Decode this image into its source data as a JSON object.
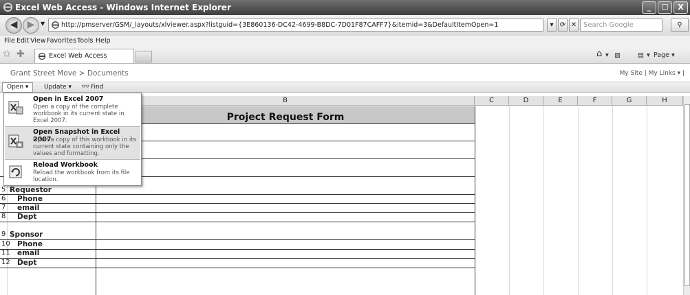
{
  "window": {
    "title": "Excel Web Access - Windows Internet Explorer",
    "controls": {
      "minimize": "_",
      "maximize": "☐",
      "close": "X"
    }
  },
  "browser": {
    "address": "http://pmserver/GSM/_layouts/xlviewer.aspx?listguid={3E860136-DC42-4699-B8DC-7D01F87CAFF7}&itemid=3&DefaultItemOpen=1",
    "search_placeholder": "Search Google",
    "menu": [
      "File",
      "Edit",
      "View",
      "Favorites",
      "Tools",
      "Help"
    ],
    "tab_title": "Excel Web Access",
    "page_label": "Page ▾"
  },
  "sharepoint": {
    "breadcrumb": "Grant Street Move > Documents",
    "links": "My Site  |  My Links ▾  |"
  },
  "excel_toolbar": {
    "open_label": "Open ▾",
    "update_label": "Update ▾",
    "find_label": "Find"
  },
  "open_menu": [
    {
      "title": "Open in Excel 2007",
      "desc": "Open a copy of the complete workbook in its current state in Excel 2007.",
      "icon": "excel-open-icon"
    },
    {
      "title": "Open Snapshot in Excel 2007",
      "desc": "Open a copy of this workbook in its current state containing only the values and formatting.",
      "icon": "excel-snapshot-icon"
    },
    {
      "title": "Reload Workbook",
      "desc": "Reload the workbook from its file location.",
      "icon": "reload-icon"
    }
  ],
  "grid": {
    "columns": [
      "B",
      "C",
      "D",
      "E",
      "F",
      "G",
      "H"
    ],
    "form_title": "Project Request Form",
    "rows": [
      {
        "num": "5",
        "label": "Requestor"
      },
      {
        "num": "6",
        "label": "Phone"
      },
      {
        "num": "7",
        "label": "email"
      },
      {
        "num": "8",
        "label": "Dept"
      },
      {
        "num": "9",
        "label": "Sponsor"
      },
      {
        "num": "10",
        "label": "Phone"
      },
      {
        "num": "11",
        "label": "email"
      },
      {
        "num": "12",
        "label": "Dept"
      }
    ]
  }
}
